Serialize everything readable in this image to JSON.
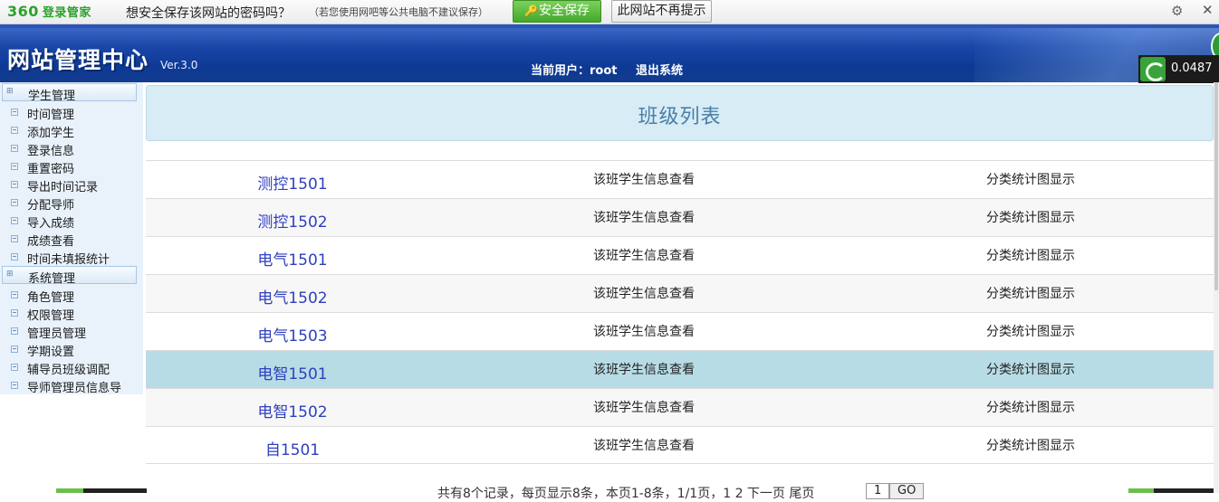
{
  "pwbar": {
    "logo_num": "360",
    "logo_text": "登录管家",
    "question": "想安全保存该网站的密码吗？",
    "hint": "（若您使用网吧等公共电脑不建议保存）",
    "save_label": "安全保存",
    "no_prompt_label": "此网站不再提示"
  },
  "header": {
    "brand": "网站管理中心",
    "version": "Ver.3.0",
    "current_user": "当前用户：root",
    "logout": "退出系统"
  },
  "netspeed": {
    "value": "0.0487"
  },
  "sidebar": {
    "group1": "学生管理",
    "items1": [
      "时间管理",
      "添加学生",
      "登录信息",
      "重置密码",
      "导出时间记录",
      "分配导师",
      "导入成绩",
      "成绩查看",
      "时间未填报统计"
    ],
    "group2": "系统管理",
    "items2": [
      "角色管理",
      "权限管理",
      "管理员管理",
      "学期设置",
      "辅导员班级调配",
      "导师管理员信息导"
    ]
  },
  "main": {
    "title": "班级列表",
    "info_label": "该班学生信息查看",
    "stat_label": "分类统计图显示",
    "classes": [
      "测控1501",
      "测控1502",
      "电气1501",
      "电气1502",
      "电气1503",
      "电智1501",
      "电智1502",
      "自1501"
    ],
    "highlighted_index": 5
  },
  "pager": {
    "text": "共有8个记录，每页显示8条，本页1-8条，1/1页，1 2 下一页 尾页",
    "page_value": "1",
    "go_label": "GO"
  },
  "colors": {
    "header_blue": "#1946a8",
    "row_highlight": "#b8dce5",
    "class_link": "#2f3fbf",
    "accent_green": "#45a82c"
  }
}
